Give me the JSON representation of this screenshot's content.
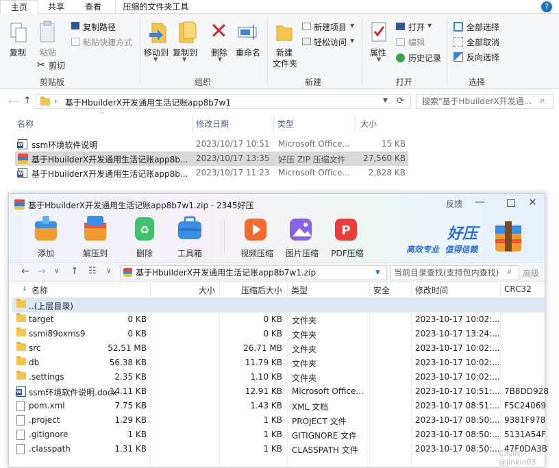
{
  "explorer": {
    "tabs": [
      "主页",
      "共享",
      "查看",
      "压缩的文件夹工具"
    ],
    "ribbon": {
      "clipboard": {
        "copy": "复制",
        "paste": "粘贴",
        "copy_path": "复制路径",
        "paste_shortcut": "粘贴快捷方式",
        "cut": "剪切",
        "group": "剪贴板"
      },
      "organize": {
        "move_to": "移动到",
        "copy_to": "复制到",
        "delete": "删除",
        "rename": "重命名",
        "group": "组织"
      },
      "new": {
        "new_folder_1": "新建",
        "new_folder_2": "文件夹",
        "new_item": "新建项目",
        "easy_access": "轻松访问",
        "group": "新建"
      },
      "open": {
        "properties": "属性",
        "open": "打开",
        "edit": "编辑",
        "history": "历史记录",
        "group": "打开"
      },
      "select": {
        "select_all": "全部选择",
        "select_none": "全部取消",
        "invert": "反向选择",
        "group": "选择"
      }
    },
    "address": "基于HbuilderX开发通用生活记账app8b7w1",
    "search_placeholder": "搜索\"基于HbuilderX开发通...",
    "columns": {
      "name": "名称",
      "date": "修改日期",
      "type": "类型",
      "size": "大小"
    },
    "files": [
      {
        "name": "ssm环境软件说明",
        "date": "2023/10/17 10:51",
        "type": "Microsoft Office...",
        "size": "15 KB"
      },
      {
        "name": "基于HbuilderX开发通用生活记账app8b...",
        "date": "2023/10/17 13:35",
        "type": "好压 ZIP 压缩文件",
        "size": "27,560 KB"
      },
      {
        "name": "基于HbuilderX开发通用生活记账app8b...",
        "date": "2023/10/17 11:23",
        "type": "Microsoft Office...",
        "size": "2,828 KB"
      }
    ]
  },
  "haozip": {
    "title": "基于HbuilderX开发通用生活记账app8b7w1.zip - 2345好压",
    "feedback": "反馈",
    "toolbar": [
      "添加",
      "解压到",
      "删除",
      "工具箱",
      "视频压缩",
      "图片压缩",
      "PDF压缩"
    ],
    "brand": "好压",
    "slogan": "高效专业  值得信赖",
    "path": "基于HbuilderX开发通用生活记账app8b7w1.zip",
    "search_placeholder": "当前目录查找(支持包内查找)",
    "advanced": "高级",
    "columns": {
      "name": "名称",
      "size": "大小",
      "packed": "压缩后大小",
      "type": "类型",
      "security": "安全",
      "modified": "修改时间",
      "crc": "CRC32"
    },
    "rows": [
      {
        "name": "..(上层目录)",
        "size": "",
        "packed": "",
        "type": "",
        "modified": "",
        "crc": "",
        "icon": "folder"
      },
      {
        "name": "target",
        "size": "0 KB",
        "packed": "0 KB",
        "type": "文件夹",
        "modified": "2023-10-17 10:02:...",
        "crc": "",
        "icon": "folder"
      },
      {
        "name": "ssmi89oxms9",
        "size": "0 KB",
        "packed": "0 KB",
        "type": "文件夹",
        "modified": "2023-10-17 13:24:...",
        "crc": "",
        "icon": "folder"
      },
      {
        "name": "src",
        "size": "52.51 MB",
        "packed": "26.71 MB",
        "type": "文件夹",
        "modified": "2023-10-17 10:02:...",
        "crc": "",
        "icon": "folder"
      },
      {
        "name": "db",
        "size": "56.38 KB",
        "packed": "11.79 KB",
        "type": "文件夹",
        "modified": "2023-10-17 10:02:...",
        "crc": "",
        "icon": "folder"
      },
      {
        "name": ".settings",
        "size": "2.35 KB",
        "packed": "1.10 KB",
        "type": "文件夹",
        "modified": "2023-10-17 10:02:...",
        "crc": "",
        "icon": "folder"
      },
      {
        "name": "ssm环境软件说明.docx",
        "size": "14.11 KB",
        "packed": "12.91 KB",
        "type": "Microsoft Office...",
        "modified": "2023-10-17 10:51:...",
        "crc": "7B8DD928",
        "icon": "word"
      },
      {
        "name": "pom.xml",
        "size": "7.75 KB",
        "packed": "1.43 KB",
        "type": "XML 文档",
        "modified": "2023-10-17 08:51:...",
        "crc": "F5C24069",
        "icon": "doc"
      },
      {
        "name": ".project",
        "size": "1.29 KB",
        "packed": "1 KB",
        "type": "PROJECT 文件",
        "modified": "2023-10-17 08:50:...",
        "crc": "9381F978",
        "icon": "doc"
      },
      {
        "name": ".gitignore",
        "size": "1 KB",
        "packed": "1 KB",
        "type": "GITIGNORE 文件",
        "modified": "2023-10-17 08:50:...",
        "crc": "5131A54F",
        "icon": "doc"
      },
      {
        "name": ".classpath",
        "size": "1.31 KB",
        "packed": "1 KB",
        "type": "CLASSPATH 文件",
        "modified": "2023-10-17 08:50:...",
        "crc": "47F0DA3B",
        "icon": "doc"
      }
    ]
  },
  "watermark": "CSDN @jinkin03"
}
